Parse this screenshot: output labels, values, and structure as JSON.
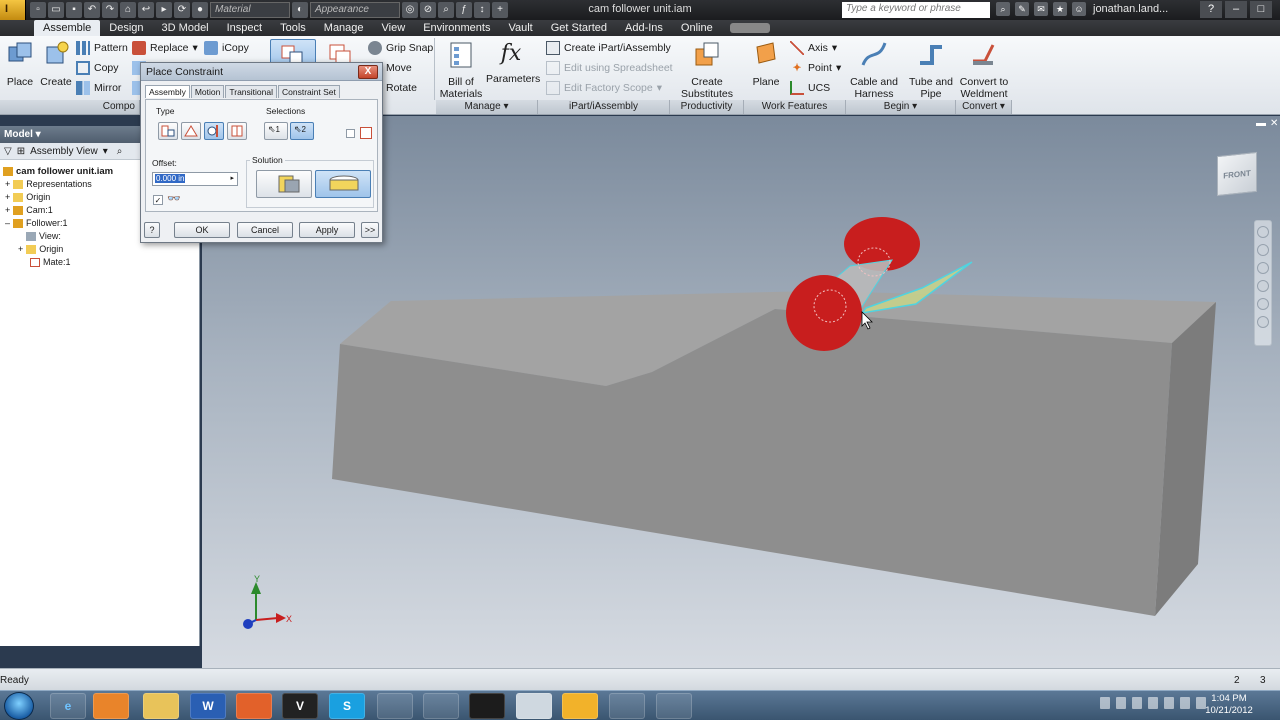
{
  "app": {
    "title": "cam follower unit.iam",
    "search_placeholder": "Type a keyword or phrase",
    "user": "jonathan.land...",
    "material_select": "Material",
    "appearance_select": "Appearance",
    "app_logo_text": "I"
  },
  "tabs": [
    "Assemble",
    "Design",
    "3D Model",
    "Inspect",
    "Tools",
    "Manage",
    "View",
    "Environments",
    "Vault",
    "Get Started",
    "Add-Ins",
    "Online"
  ],
  "ribbon": {
    "component": {
      "place": "Place",
      "create": "Create",
      "pattern": "Pattern",
      "copy": "Copy",
      "mirror": "Mirror",
      "replace": "Replace",
      "icopy": "iCopy",
      "label": "Compo"
    },
    "position": {
      "grip_snap": "Grip Snap",
      "move": "Move",
      "rotate": "Rotate"
    },
    "manage": {
      "bom_line1": "Bill of",
      "bom_line2": "Materials",
      "parameters": "Parameters",
      "label": "Manage"
    },
    "ipart": {
      "create": "Create iPart/iAssembly",
      "edit_spreadsheet": "Edit using Spreadsheet",
      "edit_factory": "Edit Factory Scope",
      "label": "iPart/iAssembly"
    },
    "productivity": {
      "line1": "Create",
      "line2": "Substitutes",
      "label": "Productivity"
    },
    "work_features": {
      "plane": "Plane",
      "axis": "Axis",
      "point": "Point",
      "ucs": "UCS",
      "label": "Work Features"
    },
    "begin": {
      "cable_line1": "Cable and",
      "cable_line2": "Harness",
      "tube_line1": "Tube and",
      "tube_line2": "Pipe",
      "label": "Begin"
    },
    "convert": {
      "line1": "Convert to",
      "line2": "Weldment",
      "label": "Convert"
    }
  },
  "browser": {
    "header": "Model",
    "view_mode": "Assembly View",
    "tree": [
      {
        "label": "cam follower unit.iam",
        "level": 0
      },
      {
        "label": "Representations",
        "level": 1
      },
      {
        "label": "Origin",
        "level": 1
      },
      {
        "label": "Cam:1",
        "level": 1
      },
      {
        "label": "Follower:1",
        "level": 1
      },
      {
        "label": "View:",
        "level": 2
      },
      {
        "label": "Origin",
        "level": 2
      },
      {
        "label": "Mate:1",
        "level": 2
      }
    ]
  },
  "dialog": {
    "title": "Place Constraint",
    "close": "X",
    "tabs": [
      "Assembly",
      "Motion",
      "Transitional",
      "Constraint Set"
    ],
    "type_label": "Type",
    "selections_label": "Selections",
    "sel1": "1",
    "sel2": "2",
    "offset_label": "Offset:",
    "offset_value": "0.000 in",
    "solution_label": "Solution",
    "ok": "OK",
    "cancel": "Cancel",
    "apply": "Apply",
    "more": ">>",
    "help": "?"
  },
  "viewcube": {
    "face": "FRONT"
  },
  "triad": {
    "x": "X",
    "y": "Y"
  },
  "status": {
    "text": "Ready",
    "count1": "2",
    "count2": "3"
  },
  "taskbar": {
    "time": "1:04 PM",
    "date": "10/21/2012",
    "apps": [
      "e",
      "",
      "",
      "W",
      "",
      "V",
      "S",
      "",
      "",
      "",
      "",
      "",
      "",
      ""
    ]
  },
  "colors": {
    "cam": "#8a8a8a",
    "follower": "#c81e1e",
    "selection": "#4fd3e0",
    "highlight_face": "#c8d48a"
  }
}
